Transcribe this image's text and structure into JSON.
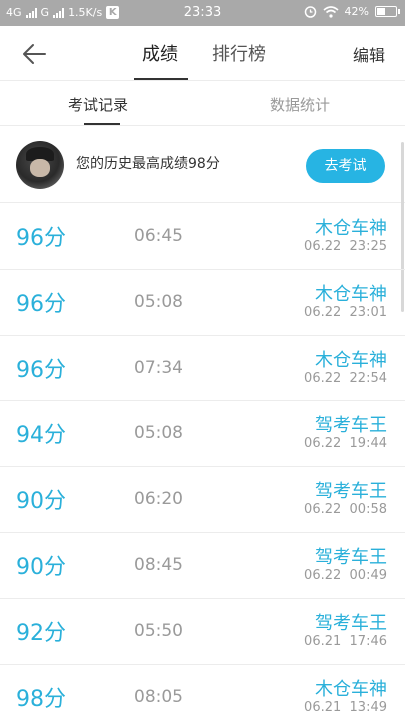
{
  "status_bar": {
    "network_1": "4G",
    "network_2": "G",
    "speed": "1.5K/s",
    "app_badge": "K",
    "time": "23:33",
    "battery": "42%"
  },
  "topnav": {
    "tabs": [
      {
        "label": "成绩",
        "active": true
      },
      {
        "label": "排行榜",
        "active": false
      }
    ],
    "edit_label": "编辑"
  },
  "subtabs": [
    {
      "label": "考试记录",
      "active": true
    },
    {
      "label": "数据统计",
      "active": false
    }
  ],
  "profile": {
    "best_score_text": "您的历史最高成绩98分",
    "go_exam_label": "去考试"
  },
  "records": [
    {
      "score": "96分",
      "duration": "06:45",
      "title": "木仓车神",
      "date": "06.22",
      "time": "23:25"
    },
    {
      "score": "96分",
      "duration": "05:08",
      "title": "木仓车神",
      "date": "06.22",
      "time": "23:01"
    },
    {
      "score": "96分",
      "duration": "07:34",
      "title": "木仓车神",
      "date": "06.22",
      "time": "22:54"
    },
    {
      "score": "94分",
      "duration": "05:08",
      "title": "驾考车王",
      "date": "06.22",
      "time": "19:44"
    },
    {
      "score": "90分",
      "duration": "06:20",
      "title": "驾考车王",
      "date": "06.22",
      "time": "00:58"
    },
    {
      "score": "90分",
      "duration": "08:45",
      "title": "驾考车王",
      "date": "06.22",
      "time": "00:49"
    },
    {
      "score": "92分",
      "duration": "05:50",
      "title": "驾考车王",
      "date": "06.21",
      "time": "17:46"
    },
    {
      "score": "98分",
      "duration": "08:05",
      "title": "木仓车神",
      "date": "06.21",
      "time": "13:49"
    }
  ],
  "colors": {
    "accent": "#27b4e3",
    "status_bar": "#a9a9a9",
    "muted_text": "#9a9a9a"
  }
}
